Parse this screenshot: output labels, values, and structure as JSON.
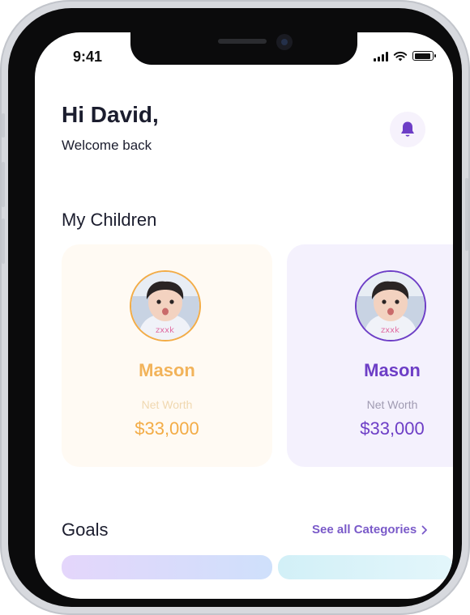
{
  "status_bar": {
    "time": "9:41"
  },
  "header": {
    "greeting": "Hi David,",
    "subtitle": "Welcome back",
    "notification_icon": "bell-icon",
    "accent_color": "#6d3ec6"
  },
  "children_section": {
    "title": "My Children",
    "cards": [
      {
        "name": "Mason",
        "net_worth_label": "Net Worth",
        "net_worth": "$33,000",
        "theme_color": "#f3ac46"
      },
      {
        "name": "Mason",
        "net_worth_label": "Net Worth",
        "net_worth": "$33,000",
        "theme_color": "#6d3ec6"
      }
    ]
  },
  "goals_section": {
    "title": "Goals",
    "see_all": "See all Categories",
    "see_all_icon": "chevron-right-icon"
  }
}
